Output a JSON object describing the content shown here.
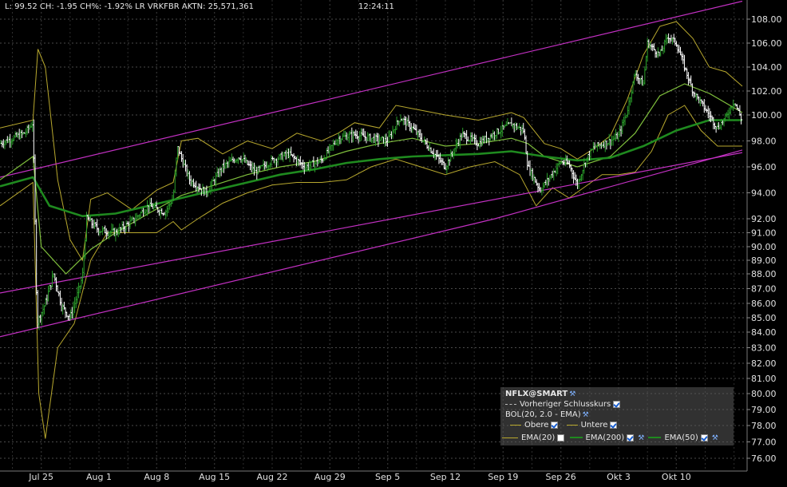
{
  "header": {
    "quote": "L: 99.52 CH: -1.95 CH%: -1.92% LR VRKFBR AKTN: 25,571,361",
    "time": "12:24:11"
  },
  "chart_data": {
    "type": "candlestick",
    "symbol": "NFLX@SMART",
    "ylim": [
      75.5,
      109.5
    ],
    "y_ticks": [
      "108.00",
      "106.00",
      "104.00",
      "102.00",
      "100.00",
      "98.00",
      "96.00",
      "94.00",
      "92.00",
      "91.00",
      "90.00",
      "89.00",
      "88.00",
      "87.00",
      "86.00",
      "85.00",
      "84.00",
      "83.00",
      "82.00",
      "81.00",
      "80.00",
      "79.00",
      "78.00",
      "77.00",
      "76.00"
    ],
    "x_labels": [
      "Jul 25",
      "Aug 1",
      "Aug 8",
      "Aug 15",
      "Aug 22",
      "Aug 29",
      "Sep 5",
      "Sep 12",
      "Sep 19",
      "Sep 26",
      "Okt 3",
      "Okt 10"
    ],
    "x_label_days": [
      5,
      12,
      19,
      26,
      33,
      40,
      47,
      54,
      61,
      68,
      75,
      82
    ],
    "day_range": [
      0,
      90
    ],
    "price_path": [
      [
        0,
        97.8
      ],
      [
        3,
        98.6
      ],
      [
        4,
        99.4
      ],
      [
        4.5,
        84.6
      ],
      [
        5.5,
        86.0
      ],
      [
        6.5,
        88.0
      ],
      [
        7.5,
        85.8
      ],
      [
        8.5,
        85.0
      ],
      [
        9.5,
        86.8
      ],
      [
        10,
        87.8
      ],
      [
        10.5,
        92.0
      ],
      [
        12,
        91.2
      ],
      [
        14,
        91.0
      ],
      [
        16,
        91.8
      ],
      [
        18,
        93.0
      ],
      [
        20,
        92.5
      ],
      [
        21,
        93.6
      ],
      [
        21.5,
        97.5
      ],
      [
        23,
        95.0
      ],
      [
        25,
        94.0
      ],
      [
        27,
        96.0
      ],
      [
        29,
        96.8
      ],
      [
        31,
        95.6
      ],
      [
        33,
        96.5
      ],
      [
        35,
        97.0
      ],
      [
        37,
        96.0
      ],
      [
        39,
        96.5
      ],
      [
        41,
        98.2
      ],
      [
        43,
        98.5
      ],
      [
        45,
        98.2
      ],
      [
        47,
        98.0
      ],
      [
        48.5,
        99.8
      ],
      [
        50,
        99.0
      ],
      [
        52,
        97.5
      ],
      [
        54,
        96.0
      ],
      [
        56,
        98.5
      ],
      [
        58,
        97.8
      ],
      [
        60,
        98.6
      ],
      [
        62,
        99.3
      ],
      [
        63.5,
        98.8
      ],
      [
        64,
        96.0
      ],
      [
        65.5,
        94.2
      ],
      [
        67,
        95.5
      ],
      [
        68,
        96.4
      ],
      [
        69,
        96.2
      ],
      [
        70,
        94.6
      ],
      [
        71,
        96.5
      ],
      [
        72,
        97.5
      ],
      [
        74,
        98.0
      ],
      [
        75,
        98.4
      ],
      [
        76,
        100.2
      ],
      [
        77,
        103.5
      ],
      [
        78,
        102.5
      ],
      [
        78.5,
        106.0
      ],
      [
        80,
        105.0
      ],
      [
        81,
        106.6
      ],
      [
        82,
        106.0
      ],
      [
        83,
        104.0
      ],
      [
        84,
        102.0
      ],
      [
        85,
        101.0
      ],
      [
        86,
        100.0
      ],
      [
        87,
        99.0
      ],
      [
        88,
        99.8
      ],
      [
        89,
        101.2
      ],
      [
        90,
        99.5
      ]
    ],
    "ema20": [
      [
        0,
        95.0
      ],
      [
        4,
        96.8
      ],
      [
        5,
        90.0
      ],
      [
        8,
        88.0
      ],
      [
        11,
        89.8
      ],
      [
        14,
        91.0
      ],
      [
        18,
        92.4
      ],
      [
        22,
        93.8
      ],
      [
        26,
        94.6
      ],
      [
        30,
        95.4
      ],
      [
        34,
        96.0
      ],
      [
        38,
        96.4
      ],
      [
        42,
        97.2
      ],
      [
        46,
        97.8
      ],
      [
        50,
        98.2
      ],
      [
        54,
        97.6
      ],
      [
        58,
        97.8
      ],
      [
        62,
        98.2
      ],
      [
        64,
        97.8
      ],
      [
        66,
        96.8
      ],
      [
        70,
        96.0
      ],
      [
        74,
        96.8
      ],
      [
        77,
        98.6
      ],
      [
        80,
        101.6
      ],
      [
        83,
        102.6
      ],
      [
        86,
        101.8
      ],
      [
        90,
        100.2
      ]
    ],
    "ema50": [
      [
        0,
        94.5
      ],
      [
        4,
        95.2
      ],
      [
        6,
        93.0
      ],
      [
        10,
        92.2
      ],
      [
        14,
        92.4
      ],
      [
        18,
        93.0
      ],
      [
        22,
        93.6
      ],
      [
        26,
        94.2
      ],
      [
        30,
        94.8
      ],
      [
        34,
        95.4
      ],
      [
        38,
        95.8
      ],
      [
        42,
        96.3
      ],
      [
        46,
        96.6
      ],
      [
        50,
        96.8
      ],
      [
        54,
        96.9
      ],
      [
        58,
        97.0
      ],
      [
        62,
        97.2
      ],
      [
        66,
        96.8
      ],
      [
        70,
        96.5
      ],
      [
        74,
        96.7
      ],
      [
        78,
        97.6
      ],
      [
        82,
        98.8
      ],
      [
        86,
        99.6
      ],
      [
        90,
        99.6
      ]
    ],
    "boll_upper": [
      [
        0,
        99.0
      ],
      [
        4,
        99.6
      ],
      [
        4.6,
        105.5
      ],
      [
        5.5,
        104.0
      ],
      [
        7,
        95.0
      ],
      [
        8.5,
        90.5
      ],
      [
        10,
        89.0
      ],
      [
        11,
        93.5
      ],
      [
        13,
        94.0
      ],
      [
        16,
        92.7
      ],
      [
        19,
        94.2
      ],
      [
        21,
        94.8
      ],
      [
        22,
        98.0
      ],
      [
        24,
        98.2
      ],
      [
        27,
        97.0
      ],
      [
        30,
        98.0
      ],
      [
        33,
        97.4
      ],
      [
        36,
        98.6
      ],
      [
        39,
        98.0
      ],
      [
        41,
        98.6
      ],
      [
        43,
        99.4
      ],
      [
        46,
        99.0
      ],
      [
        48,
        100.8
      ],
      [
        51,
        100.4
      ],
      [
        54,
        100.0
      ],
      [
        58,
        99.6
      ],
      [
        62,
        100.2
      ],
      [
        63.5,
        99.8
      ],
      [
        66,
        97.8
      ],
      [
        68,
        97.4
      ],
      [
        70,
        96.6
      ],
      [
        72,
        97.4
      ],
      [
        74,
        98.4
      ],
      [
        76,
        101.2
      ],
      [
        78,
        105.0
      ],
      [
        80,
        107.4
      ],
      [
        82,
        107.8
      ],
      [
        84,
        106.4
      ],
      [
        86,
        104.0
      ],
      [
        88,
        103.6
      ],
      [
        90,
        102.4
      ]
    ],
    "boll_lower": [
      [
        0,
        93.0
      ],
      [
        4,
        94.8
      ],
      [
        4.7,
        80.0
      ],
      [
        5.5,
        77.2
      ],
      [
        7,
        83.0
      ],
      [
        9,
        84.6
      ],
      [
        11,
        89.0
      ],
      [
        13,
        91.0
      ],
      [
        16,
        91.0
      ],
      [
        19,
        91.0
      ],
      [
        21,
        91.8
      ],
      [
        22,
        91.2
      ],
      [
        24,
        92.0
      ],
      [
        27,
        93.2
      ],
      [
        30,
        94.0
      ],
      [
        33,
        94.6
      ],
      [
        36,
        94.8
      ],
      [
        39,
        94.8
      ],
      [
        42,
        95.0
      ],
      [
        45,
        96.0
      ],
      [
        48,
        96.6
      ],
      [
        51,
        96.0
      ],
      [
        54,
        95.4
      ],
      [
        57,
        96.0
      ],
      [
        60,
        96.4
      ],
      [
        63,
        95.4
      ],
      [
        65,
        93.0
      ],
      [
        67,
        94.4
      ],
      [
        69,
        93.6
      ],
      [
        71,
        94.5
      ],
      [
        73,
        95.4
      ],
      [
        75,
        95.4
      ],
      [
        77,
        95.6
      ],
      [
        79,
        97.2
      ],
      [
        81,
        100.0
      ],
      [
        83,
        100.8
      ],
      [
        85,
        98.8
      ],
      [
        87,
        97.6
      ],
      [
        90,
        97.6
      ]
    ],
    "trend_lines": [
      [
        [
          0,
          95.2
        ],
        [
          90,
          109.5
        ]
      ],
      [
        [
          0,
          86.7
        ],
        [
          90,
          97.1
        ]
      ],
      [
        [
          0,
          83.7
        ],
        [
          60,
          92.0
        ],
        [
          90,
          97.3
        ]
      ]
    ],
    "colors": {
      "price_up": "#2a9c2a",
      "price_down": "#ffffff",
      "ema20": "#7fbf3c",
      "ema50": "#1f8a1f",
      "bollinger": "#b8a82e",
      "trend": "#c230c2",
      "grid": "#4a4a4a"
    }
  },
  "legend": {
    "title": "NFLX@SMART",
    "prev_close": "Vorheriger Schlusskurs",
    "boll": "BOL(20, 2.0 - EMA)",
    "upper": "Obere",
    "lower": "Untere",
    "ema20": "EMA(20)",
    "ema200": "EMA(200)",
    "ema50": "EMA(50)"
  }
}
